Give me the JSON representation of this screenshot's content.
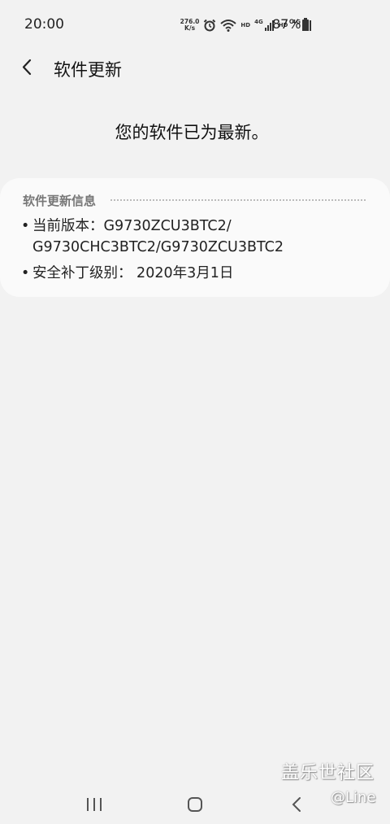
{
  "status_bar": {
    "time": "20:00",
    "net_speed_value": "276.0",
    "net_speed_unit": "K/s",
    "hd1": "HD",
    "net1": "4G",
    "hd2": "HD",
    "net2": "4G",
    "battery": "87%",
    "icons": [
      "alarm-icon",
      "wifi-icon",
      "signal-icon",
      "battery-icon"
    ]
  },
  "header": {
    "title": "软件更新"
  },
  "status_message": "您的软件已为最新。",
  "info_card": {
    "title": "软件更新信息",
    "version_line1": "当前版本：G9730ZCU3BTC2/",
    "version_line2": "G9730CHC3BTC2/G9730ZCU3BTC2",
    "patch_line": "安全补丁级别： 2020年3月1日"
  },
  "watermark": {
    "site": "盖乐世社区",
    "user": "@Line"
  },
  "colors": {
    "background": "#f2f2f2",
    "card": "#fafafa",
    "text": "#111111",
    "muted": "#777777"
  }
}
